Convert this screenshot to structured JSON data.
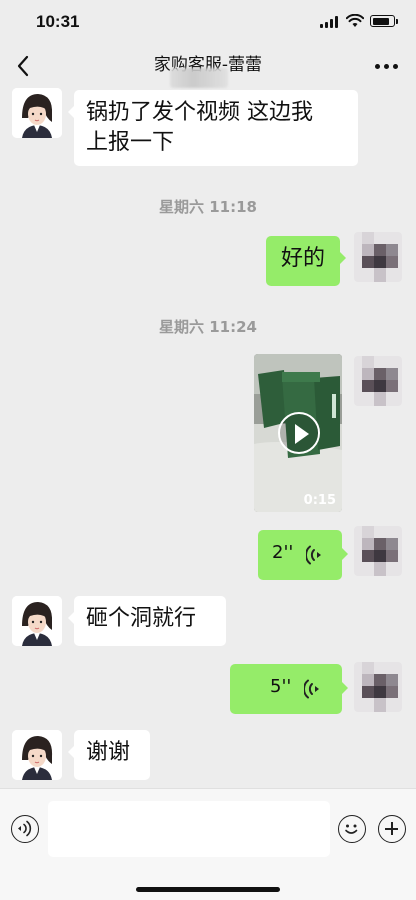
{
  "status_bar": {
    "time": "10:31",
    "battery_level_pct": 85
  },
  "nav": {
    "title": "家购客服-蕾蕾",
    "back_icon": "chevron-left-icon",
    "more_icon": "more-dots-icon"
  },
  "messages": [
    {
      "side": "left",
      "type": "text",
      "text_line1": "锅扔了发个视频 这边我",
      "text_line2": "上报一下"
    },
    {
      "type": "timestamp",
      "text": "星期六 11:18"
    },
    {
      "side": "right",
      "type": "text",
      "text": "好的"
    },
    {
      "type": "timestamp",
      "text": "星期六 11:24"
    },
    {
      "side": "right",
      "type": "video",
      "duration": "0:15",
      "play_icon": "play-icon"
    },
    {
      "side": "right",
      "type": "voice",
      "duration": "2''",
      "icon": "voice-wave-icon"
    },
    {
      "side": "left",
      "type": "text",
      "text": "砸个洞就行"
    },
    {
      "side": "right",
      "type": "voice",
      "duration": "5''",
      "icon": "voice-wave-icon"
    },
    {
      "side": "left",
      "type": "text",
      "text": "谢谢"
    }
  ],
  "input_bar": {
    "voice_icon": "voice-mode-icon",
    "input_placeholder": "",
    "emoji_icon": "emoji-icon",
    "plus_icon": "plus-icon"
  },
  "colors": {
    "background": "#ededed",
    "sent_bubble": "#95ec69",
    "received_bubble": "#ffffff",
    "timestamp_text": "#9a9a9a"
  }
}
